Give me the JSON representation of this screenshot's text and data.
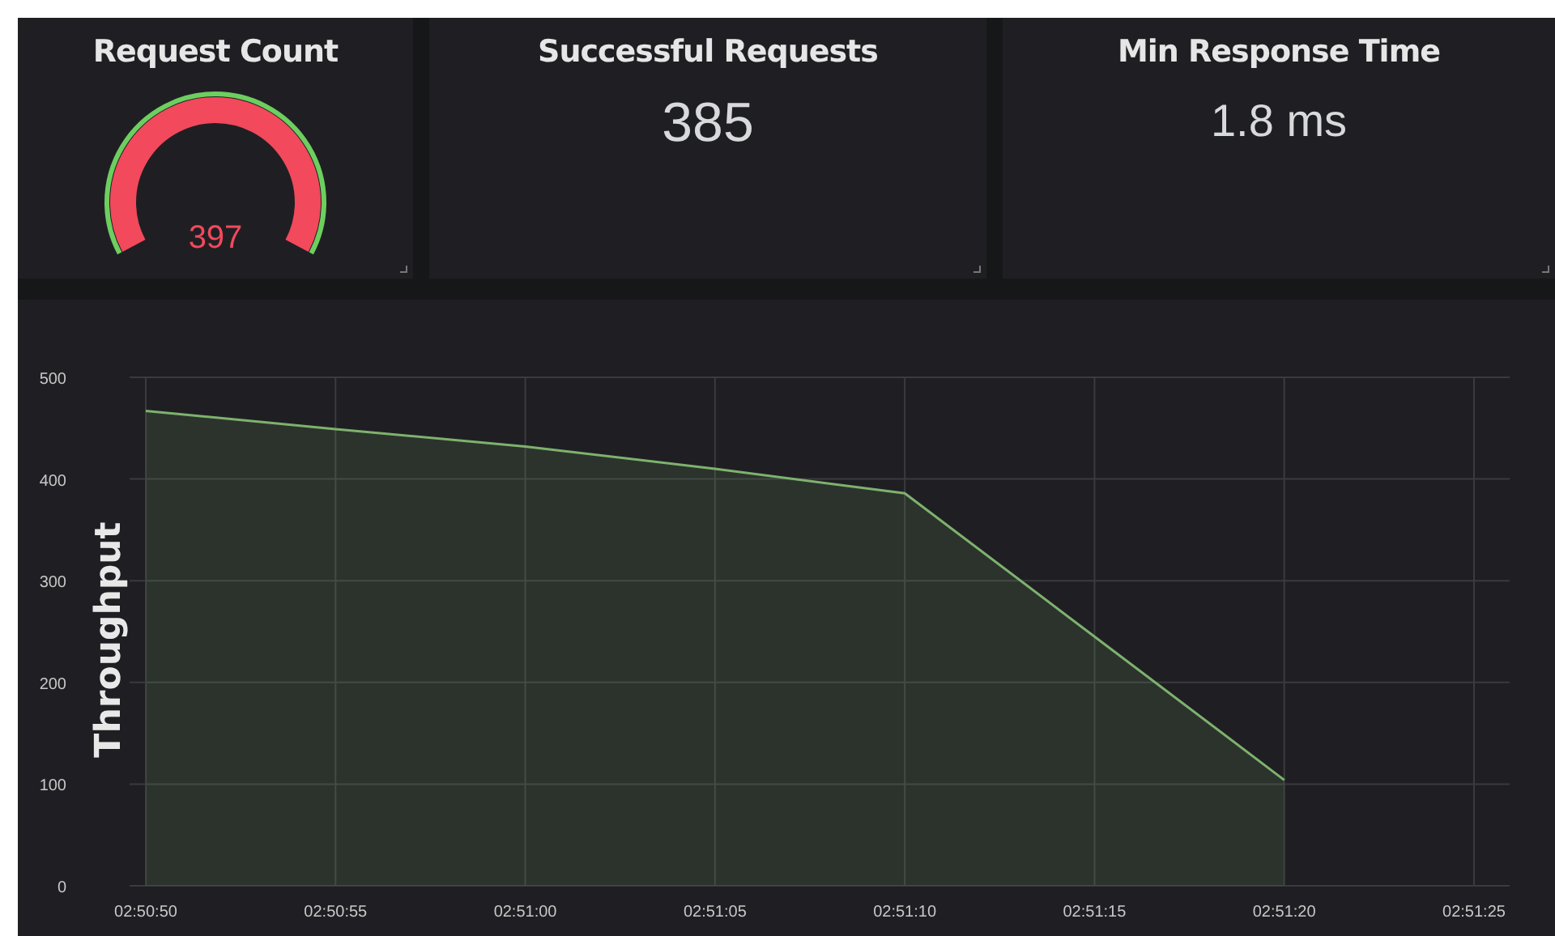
{
  "stats": [
    {
      "kind": "gauge",
      "title": "Request Count",
      "value": "397",
      "level": 1
    },
    {
      "kind": "stat",
      "title": "Successful Requests",
      "value": "385"
    },
    {
      "kind": "stat",
      "title": "Min Response Time",
      "value": "1.8 ms"
    }
  ],
  "throughput": {
    "chart_data": {
      "type": "area",
      "ylabel": "Throughput",
      "categories": [
        "02:50:50",
        "02:50:55",
        "02:51:00",
        "02:51:05",
        "02:51:10",
        "02:51:15",
        "02:51:20",
        "02:51:25"
      ],
      "grid": true,
      "series": [
        {
          "color": "#7eb26d",
          "values": [
            467,
            449,
            432,
            410,
            386,
            245,
            104,
            null
          ]
        }
      ],
      "ylim": [
        0,
        500
      ],
      "yticks": [
        0,
        100,
        200,
        300,
        400,
        500
      ]
    }
  }
}
